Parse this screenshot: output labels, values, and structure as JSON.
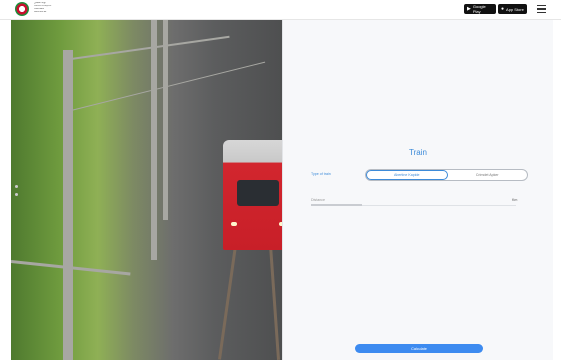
{
  "header": {
    "logo_text": [
      "بوابة القياس",
      "Carbon Footprint",
      "Calculator",
      "www.site.ae"
    ],
    "google_play": {
      "small": "GET IT ON",
      "label": "Google Play"
    },
    "app_store": {
      "small": "Download on the",
      "label": "App Store"
    }
  },
  "panel": {
    "title": "Train",
    "type_label": "Type of train",
    "options": [
      "Abertine Kapide",
      "Crimdet Apker"
    ],
    "selected_option": 0,
    "distance_label": "Distance",
    "distance_value": "",
    "distance_fraction": 0.25,
    "unit": "Km",
    "calculate_label": "Calculate"
  },
  "colors": {
    "accent": "#3d8bd9",
    "button": "#3d8bf0",
    "train": "#c81f28"
  },
  "icons": [
    "logo",
    "google-play-icon",
    "apple-icon",
    "menu-icon"
  ]
}
